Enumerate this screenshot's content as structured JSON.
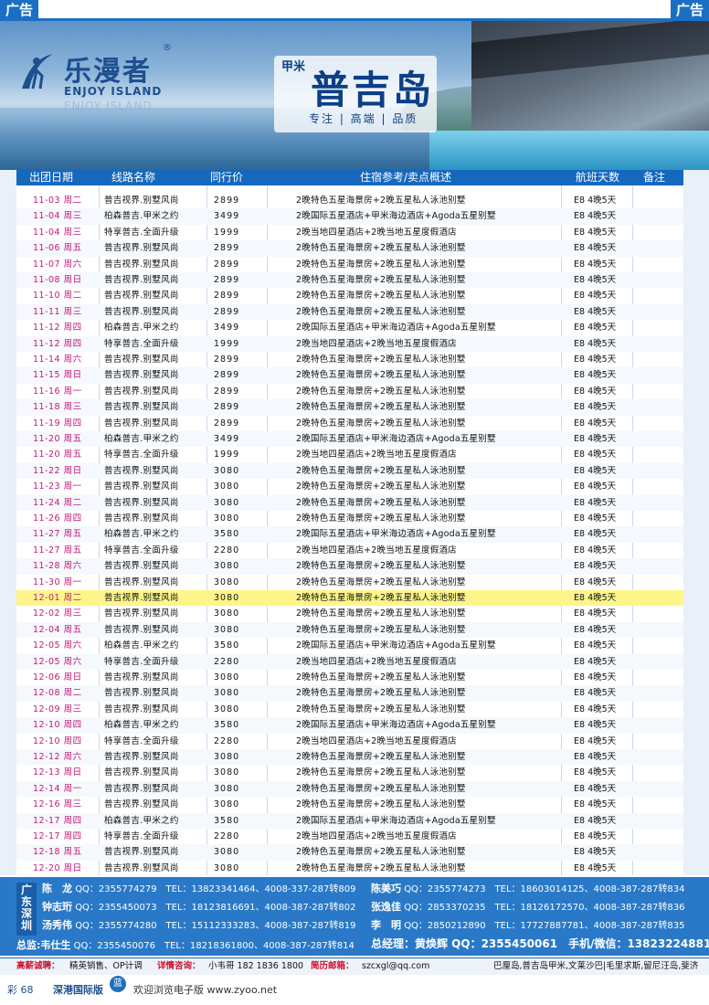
{
  "ad_label": "广告",
  "brand": {
    "name_cn": "乐漫者",
    "reg_mark": "®",
    "name_en": "ENJOY ISLAND",
    "tm": "TM"
  },
  "title": {
    "main": "普吉岛",
    "vertical": "甲米",
    "krabi": "Krabi",
    "tags": "专注 | 高端 | 品质"
  },
  "table_headers": [
    "出团日期",
    "线路名称",
    "同行价",
    "住宿参考/卖点概述",
    "航班天数",
    "备注"
  ],
  "rows": [
    {
      "date": "11-03 周二",
      "route": "普吉视界.别墅风尚",
      "price": "2899",
      "hotel": "2晚特色五星海景房+2晚五星私人泳池别墅",
      "flight": "E8 4晚5天"
    },
    {
      "date": "11-04 周三",
      "route": "柏森普吉.甲米之约",
      "price": "3499",
      "hotel": "2晚国际五星酒店+甲米海边酒店+Agoda五星别墅",
      "flight": "E8 4晚5天"
    },
    {
      "date": "11-04 周三",
      "route": "特享普吉.全面升级",
      "price": "1999",
      "hotel": "2晚当地四星酒店+2晚当地五星度假酒店",
      "flight": "E8 4晚5天"
    },
    {
      "date": "11-06 周五",
      "route": "普吉视界.别墅风尚",
      "price": "2899",
      "hotel": "2晚特色五星海景房+2晚五星私人泳池别墅",
      "flight": "E8 4晚5天"
    },
    {
      "date": "11-07 周六",
      "route": "普吉视界.别墅风尚",
      "price": "2899",
      "hotel": "2晚特色五星海景房+2晚五星私人泳池别墅",
      "flight": "E8 4晚5天"
    },
    {
      "date": "11-08 周日",
      "route": "普吉视界.别墅风尚",
      "price": "2899",
      "hotel": "2晚特色五星海景房+2晚五星私人泳池别墅",
      "flight": "E8 4晚5天"
    },
    {
      "date": "11-10 周二",
      "route": "普吉视界.别墅风尚",
      "price": "2899",
      "hotel": "2晚特色五星海景房+2晚五星私人泳池别墅",
      "flight": "E8 4晚5天"
    },
    {
      "date": "11-11 周三",
      "route": "普吉视界.别墅风尚",
      "price": "2899",
      "hotel": "2晚特色五星海景房+2晚五星私人泳池别墅",
      "flight": "E8 4晚5天"
    },
    {
      "date": "11-12 周四",
      "route": "柏森普吉.甲米之约",
      "price": "3499",
      "hotel": "2晚国际五星酒店+甲米海边酒店+Agoda五星别墅",
      "flight": "E8 4晚5天"
    },
    {
      "date": "11-12 周四",
      "route": "特享普吉.全面升级",
      "price": "1999",
      "hotel": "2晚当地四星酒店+2晚当地五星度假酒店",
      "flight": "E8 4晚5天"
    },
    {
      "date": "11-14 周六",
      "route": "普吉视界.别墅风尚",
      "price": "2899",
      "hotel": "2晚特色五星海景房+2晚五星私人泳池别墅",
      "flight": "E8 4晚5天"
    },
    {
      "date": "11-15 周日",
      "route": "普吉视界.别墅风尚",
      "price": "2899",
      "hotel": "2晚特色五星海景房+2晚五星私人泳池别墅",
      "flight": "E8 4晚5天"
    },
    {
      "date": "11-16 周一",
      "route": "普吉视界.别墅风尚",
      "price": "2899",
      "hotel": "2晚特色五星海景房+2晚五星私人泳池别墅",
      "flight": "E8 4晚5天"
    },
    {
      "date": "11-18 周三",
      "route": "普吉视界.别墅风尚",
      "price": "2899",
      "hotel": "2晚特色五星海景房+2晚五星私人泳池别墅",
      "flight": "E8 4晚5天"
    },
    {
      "date": "11-19 周四",
      "route": "普吉视界.别墅风尚",
      "price": "2899",
      "hotel": "2晚特色五星海景房+2晚五星私人泳池别墅",
      "flight": "E8 4晚5天"
    },
    {
      "date": "11-20 周五",
      "route": "柏森普吉.甲米之约",
      "price": "3499",
      "hotel": "2晚国际五星酒店+甲米海边酒店+Agoda五星别墅",
      "flight": "E8 4晚5天"
    },
    {
      "date": "11-20 周五",
      "route": "特享普吉.全面升级",
      "price": "1999",
      "hotel": "2晚当地四星酒店+2晚当地五星度假酒店",
      "flight": "E8 4晚5天"
    },
    {
      "date": "11-22 周日",
      "route": "普吉视界.别墅风尚",
      "price": "3080",
      "hotel": "2晚特色五星海景房+2晚五星私人泳池别墅",
      "flight": "E8 4晚5天"
    },
    {
      "date": "11-23 周一",
      "route": "普吉视界.别墅风尚",
      "price": "3080",
      "hotel": "2晚特色五星海景房+2晚五星私人泳池别墅",
      "flight": "E8 4晚5天"
    },
    {
      "date": "11-24 周二",
      "route": "普吉视界.别墅风尚",
      "price": "3080",
      "hotel": "2晚特色五星海景房+2晚五星私人泳池别墅",
      "flight": "E8 4晚5天"
    },
    {
      "date": "11-26 周四",
      "route": "普吉视界.别墅风尚",
      "price": "3080",
      "hotel": "2晚特色五星海景房+2晚五星私人泳池别墅",
      "flight": "E8 4晚5天"
    },
    {
      "date": "11-27 周五",
      "route": "柏森普吉.甲米之约",
      "price": "3580",
      "hotel": "2晚国际五星酒店+甲米海边酒店+Agoda五星别墅",
      "flight": "E8 4晚5天"
    },
    {
      "date": "11-27 周五",
      "route": "特享普吉.全面升级",
      "price": "2280",
      "hotel": "2晚当地四星酒店+2晚当地五星度假酒店",
      "flight": "E8 4晚5天"
    },
    {
      "date": "11-28 周六",
      "route": "普吉视界.别墅风尚",
      "price": "3080",
      "hotel": "2晚特色五星海景房+2晚五星私人泳池别墅",
      "flight": "E8 4晚5天"
    },
    {
      "date": "11-30 周一",
      "route": "普吉视界.别墅风尚",
      "price": "3080",
      "hotel": "2晚特色五星海景房+2晚五星私人泳池别墅",
      "flight": "E8 4晚5天"
    },
    {
      "date": "12-01 周二",
      "route": "普吉视界.别墅风尚",
      "price": "3080",
      "hotel": "2晚特色五星海景房+2晚五星私人泳池别墅",
      "flight": "E8 4晚5天",
      "highlight": true
    },
    {
      "date": "12-02 周三",
      "route": "普吉视界.别墅风尚",
      "price": "3080",
      "hotel": "2晚特色五星海景房+2晚五星私人泳池别墅",
      "flight": "E8 4晚5天"
    },
    {
      "date": "12-04 周五",
      "route": "普吉视界.别墅风尚",
      "price": "3080",
      "hotel": "2晚特色五星海景房+2晚五星私人泳池别墅",
      "flight": "E8 4晚5天"
    },
    {
      "date": "12-05 周六",
      "route": "柏森普吉.甲米之约",
      "price": "3580",
      "hotel": "2晚国际五星酒店+甲米海边酒店+Agoda五星别墅",
      "flight": "E8 4晚5天"
    },
    {
      "date": "12-05 周六",
      "route": "特享普吉.全面升级",
      "price": "2280",
      "hotel": "2晚当地四星酒店+2晚当地五星度假酒店",
      "flight": "E8 4晚5天"
    },
    {
      "date": "12-06 周日",
      "route": "普吉视界.别墅风尚",
      "price": "3080",
      "hotel": "2晚特色五星海景房+2晚五星私人泳池别墅",
      "flight": "E8 4晚5天"
    },
    {
      "date": "12-08 周二",
      "route": "普吉视界.别墅风尚",
      "price": "3080",
      "hotel": "2晚特色五星海景房+2晚五星私人泳池别墅",
      "flight": "E8 4晚5天"
    },
    {
      "date": "12-09 周三",
      "route": "普吉视界.别墅风尚",
      "price": "3080",
      "hotel": "2晚特色五星海景房+2晚五星私人泳池别墅",
      "flight": "E8 4晚5天"
    },
    {
      "date": "12-10 周四",
      "route": "柏森普吉.甲米之约",
      "price": "3580",
      "hotel": "2晚国际五星酒店+甲米海边酒店+Agoda五星别墅",
      "flight": "E8 4晚5天"
    },
    {
      "date": "12-10 周四",
      "route": "特享普吉.全面升级",
      "price": "2280",
      "hotel": "2晚当地四星酒店+2晚当地五星度假酒店",
      "flight": "E8 4晚5天"
    },
    {
      "date": "12-12 周六",
      "route": "普吉视界.别墅风尚",
      "price": "3080",
      "hotel": "2晚特色五星海景房+2晚五星私人泳池别墅",
      "flight": "E8 4晚5天"
    },
    {
      "date": "12-13 周日",
      "route": "普吉视界.别墅风尚",
      "price": "3080",
      "hotel": "2晚特色五星海景房+2晚五星私人泳池别墅",
      "flight": "E8 4晚5天"
    },
    {
      "date": "12-14 周一",
      "route": "普吉视界.别墅风尚",
      "price": "3080",
      "hotel": "2晚特色五星海景房+2晚五星私人泳池别墅",
      "flight": "E8 4晚5天"
    },
    {
      "date": "12-16 周三",
      "route": "普吉视界.别墅风尚",
      "price": "3080",
      "hotel": "2晚特色五星海景房+2晚五星私人泳池别墅",
      "flight": "E8 4晚5天"
    },
    {
      "date": "12-17 周四",
      "route": "柏森普吉.甲米之约",
      "price": "3580",
      "hotel": "2晚国际五星酒店+甲米海边酒店+Agoda五星别墅",
      "flight": "E8 4晚5天"
    },
    {
      "date": "12-17 周四",
      "route": "特享普吉.全面升级",
      "price": "2280",
      "hotel": "2晚当地四星酒店+2晚当地五星度假酒店",
      "flight": "E8 4晚5天"
    },
    {
      "date": "12-18 周五",
      "route": "普吉视界.别墅风尚",
      "price": "3080",
      "hotel": "2晚特色五星海景房+2晚五星私人泳池别墅",
      "flight": "E8 4晚5天"
    },
    {
      "date": "12-20 周日",
      "route": "普吉视界.别墅风尚",
      "price": "3080",
      "hotel": "2晚特色五星海景房+2晚五星私人泳池别墅",
      "flight": "E8 4晚5天"
    }
  ],
  "contact": {
    "city": [
      "广",
      "东",
      "深",
      "圳"
    ],
    "people": [
      {
        "name": "陈　龙",
        "info": "QQ：2355774279　TEL：13823341464、4008-337-287转809"
      },
      {
        "name": "陈美巧",
        "info": "QQ：2355774273　TEL：18603014125、4008-387-287转834"
      },
      {
        "name": "钟志珩",
        "info": "QQ：2355450073　TEL：18123816691、4008-387-287转802"
      },
      {
        "name": "张逸佳",
        "info": "QQ：2853370235　TEL：18126172570、4008-387-287转836"
      },
      {
        "name": "汤秀伟",
        "info": "QQ：2355774280　TEL：15112333283、4008-387-287转819"
      },
      {
        "name": "李　明",
        "info": "QQ：2850212890　TEL：17727887781、4008-387-287转835"
      },
      {
        "name": "总监:韦仕生",
        "info": "QQ：2355450076　TEL：18218361800、4008-387-287转814"
      }
    ],
    "chief": "总经理：黄焕辉 QQ：2355450061　手机/微信：13823224881"
  },
  "recruit": {
    "hire_label": "高薪诚聘：",
    "hire_text": "精英销售、OP计调",
    "consult_label": "详情咨询：",
    "consult_text": "小韦哥 182 1836 1800",
    "mail_label": "简历邮箱：",
    "mail_text": "szcxgl@qq.com",
    "destinations": "巴厘岛,普吉岛甲米,文莱沙巴|毛里求斯,留尼汪岛,斐济"
  },
  "footer": {
    "page": "彩 68",
    "edition": "深港国际版",
    "badge": "蓝",
    "web": "欢迎浏览电子版 www.zyoo.net"
  }
}
